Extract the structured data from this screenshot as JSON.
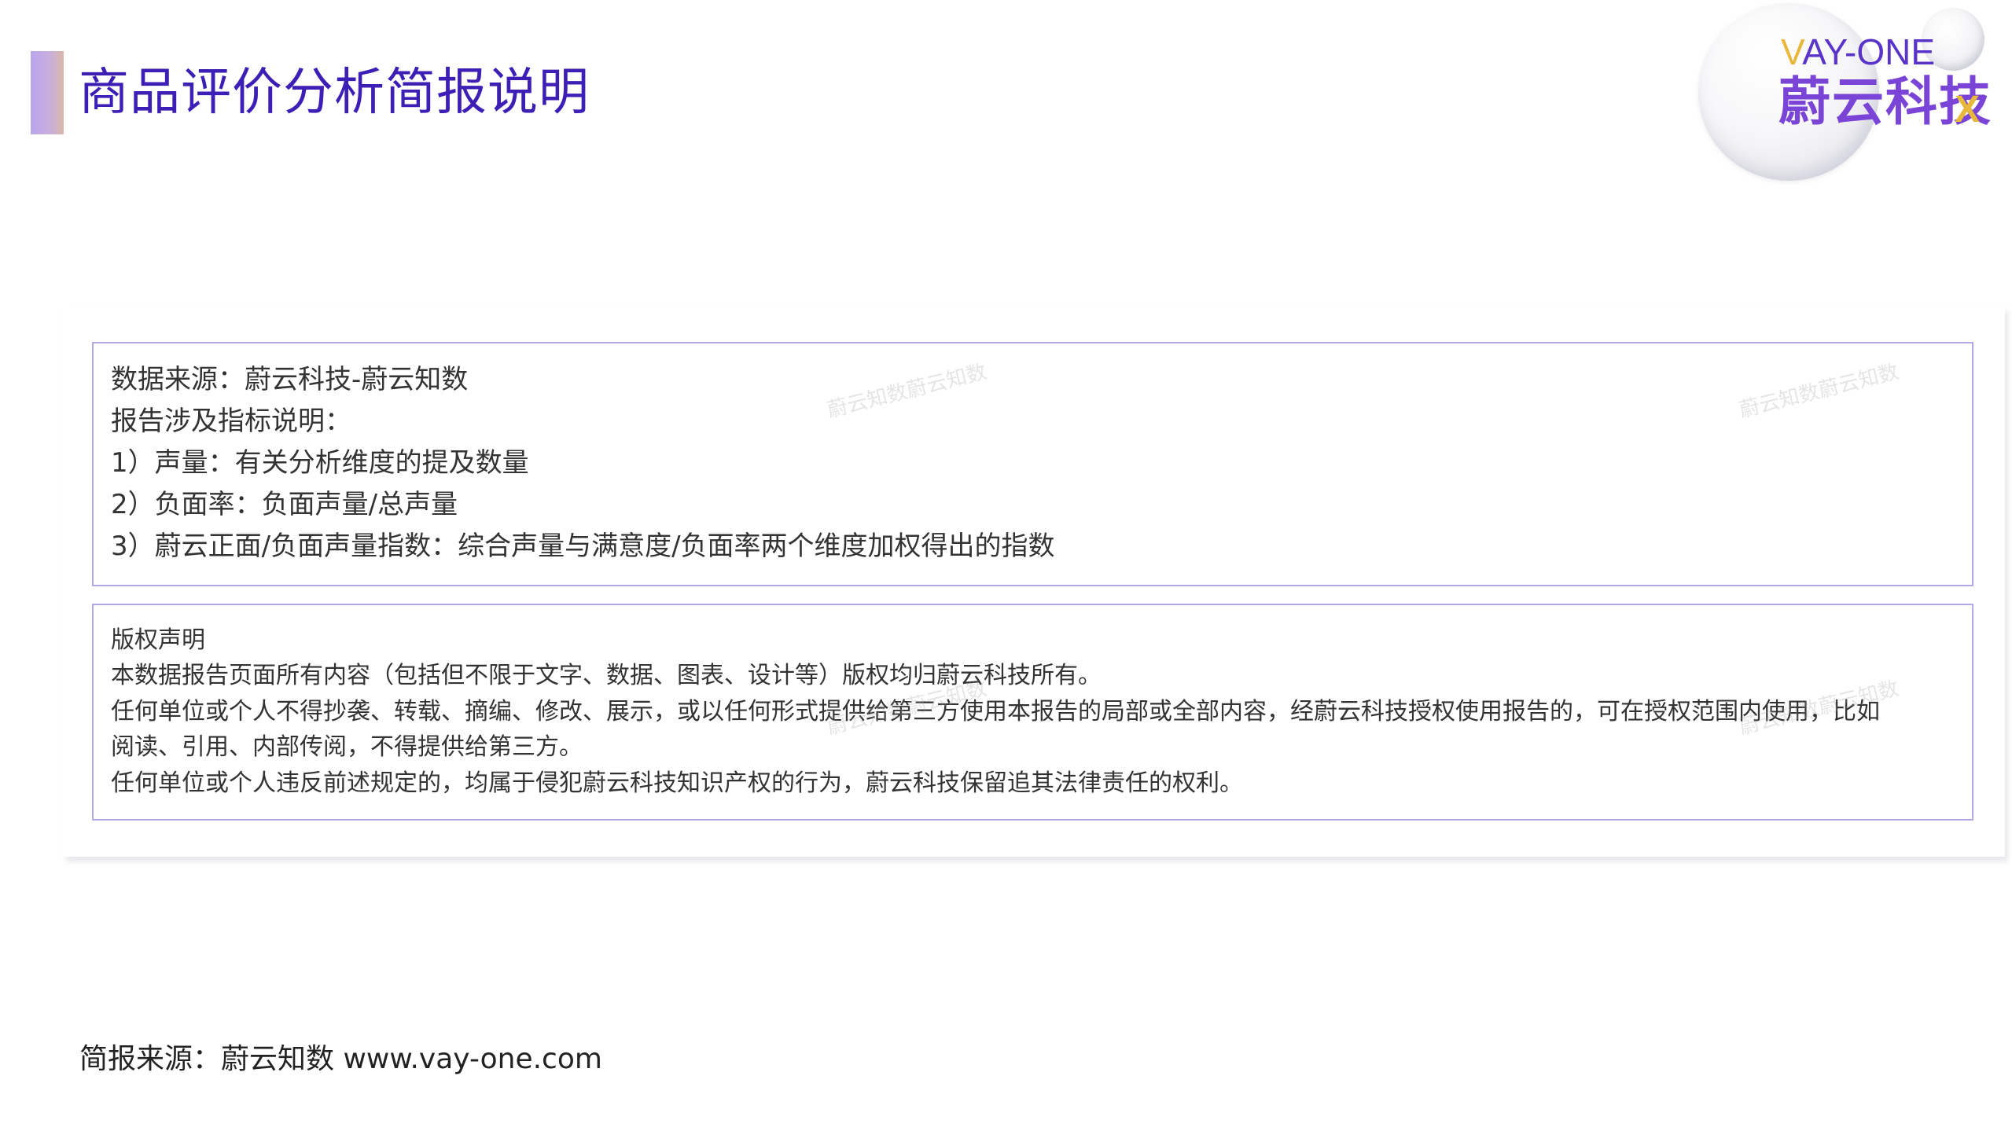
{
  "header": {
    "title": "商品评价分析简报说明"
  },
  "logo": {
    "en_v": "V",
    "en_rest": "AY-ONE",
    "cn": "蔚云科技",
    "x_mark": "X"
  },
  "watermark": {
    "text": "蔚云知数蔚云知数"
  },
  "data_box": {
    "lines": [
      "数据来源：蔚云科技-蔚云知数",
      "报告涉及指标说明：",
      "1）声量：有关分析维度的提及数量",
      "2）负面率：负面声量/总声量",
      "3）蔚云正面/负面声量指数：综合声量与满意度/负面率两个维度加权得出的指数"
    ]
  },
  "copyright_box": {
    "heading": "版权声明",
    "lines": [
      "本数据报告页面所有内容（包括但不限于文字、数据、图表、设计等）版权均归蔚云科技所有。",
      "任何单位或个人不得抄袭、转载、摘编、修改、展示，或以任何形式提供给第三方使用本报告的局部或全部内容，经蔚云科技授权使用报告的，可在授权范围内使用，比如",
      "阅读、引用、内部传阅，不得提供给第三方。",
      "任何单位或个人违反前述规定的，均属于侵犯蔚云科技知识产权的行为，蔚云科技保留追其法律责任的权利。"
    ]
  },
  "footer": {
    "source": "简报来源：蔚云知数 www.vay-one.com"
  }
}
